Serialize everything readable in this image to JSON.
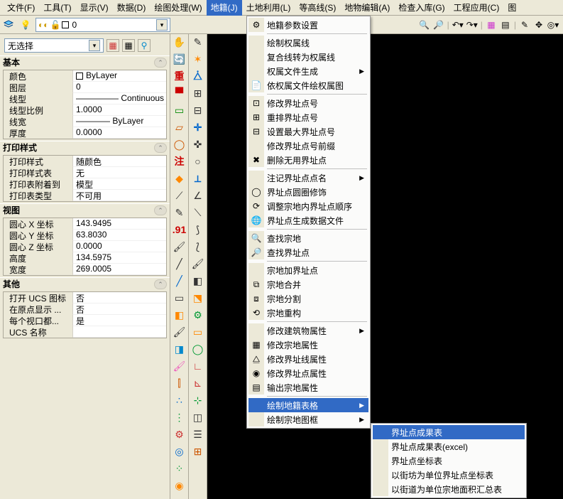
{
  "menubar": {
    "items": [
      "文件(F)",
      "工具(T)",
      "显示(V)",
      "数据(D)",
      "绘图处理(W)",
      "地籍(J)",
      "土地利用(L)",
      "等高线(S)",
      "地物编辑(A)",
      "检查入库(G)",
      "工程应用(C)",
      "图"
    ]
  },
  "layer_combo": {
    "value": "0"
  },
  "selection_combo": {
    "value": "无选择"
  },
  "groups": {
    "basic": {
      "title": "基本",
      "rows": [
        {
          "label": "颜色",
          "value": "ByLayer",
          "swatch": true
        },
        {
          "label": "图层",
          "value": "0"
        },
        {
          "label": "线型",
          "value": "————— Continuous"
        },
        {
          "label": "线型比例",
          "value": "1.0000"
        },
        {
          "label": "线宽",
          "value": "———— ByLayer"
        },
        {
          "label": "厚度",
          "value": "0.0000"
        }
      ]
    },
    "print": {
      "title": "打印样式",
      "rows": [
        {
          "label": "打印样式",
          "value": "随颜色"
        },
        {
          "label": "打印样式表",
          "value": "无"
        },
        {
          "label": "打印表附着到",
          "value": "模型"
        },
        {
          "label": "打印表类型",
          "value": "不可用"
        }
      ]
    },
    "view": {
      "title": "视图",
      "rows": [
        {
          "label": "圆心 X 坐标",
          "value": "143.9495"
        },
        {
          "label": "圆心 Y 坐标",
          "value": "63.8030"
        },
        {
          "label": "圆心 Z 坐标",
          "value": "0.0000"
        },
        {
          "label": "高度",
          "value": "134.5975"
        },
        {
          "label": "宽度",
          "value": "269.0005"
        }
      ]
    },
    "other": {
      "title": "其他",
      "rows": [
        {
          "label": "打开 UCS 图标",
          "value": "否"
        },
        {
          "label": "在原点显示 ...",
          "value": "否"
        },
        {
          "label": "每个视口都...",
          "value": "是"
        },
        {
          "label": "UCS 名称",
          "value": ""
        }
      ]
    }
  },
  "menu1": {
    "items": [
      {
        "t": "地籍参数设置",
        "ico": "gear"
      },
      {
        "t": "-"
      },
      {
        "t": "绘制权属线"
      },
      {
        "t": "复合线转为权属线"
      },
      {
        "t": "权属文件生成",
        "sub": true
      },
      {
        "t": "依权属文件绘权属图",
        "ico": "doc"
      },
      {
        "t": "-"
      },
      {
        "t": "修改界址点号",
        "ico": "pt1"
      },
      {
        "t": "重排界址点号",
        "ico": "grid"
      },
      {
        "t": "设置最大界址点号",
        "ico": "pt2"
      },
      {
        "t": "修改界址点号前缀"
      },
      {
        "t": "删除无用界址点",
        "ico": "del"
      },
      {
        "t": "-"
      },
      {
        "t": "注记界址点点名",
        "sub": true
      },
      {
        "t": "界址点圆圈修饰",
        "ico": "circ"
      },
      {
        "t": "调整宗地内界址点顺序",
        "ico": "ord"
      },
      {
        "t": "界址点生成数据文件",
        "ico": "globe"
      },
      {
        "t": "-"
      },
      {
        "t": "查找宗地",
        "ico": "find"
      },
      {
        "t": "查找界址点",
        "ico": "find2"
      },
      {
        "t": "-"
      },
      {
        "t": "宗地加界址点"
      },
      {
        "t": "宗地合并",
        "ico": "merge"
      },
      {
        "t": "宗地分割",
        "ico": "split"
      },
      {
        "t": "宗地重构",
        "ico": "recon"
      },
      {
        "t": "-"
      },
      {
        "t": "修改建筑物属性",
        "sub": true
      },
      {
        "t": "修改宗地属性",
        "ico": "p1"
      },
      {
        "t": "修改界址线属性",
        "ico": "p2"
      },
      {
        "t": "修改界址点属性",
        "ico": "p3"
      },
      {
        "t": "输出宗地属性",
        "ico": "out"
      },
      {
        "t": "-"
      },
      {
        "t": "绘制地籍表格",
        "sub": true,
        "hi": true
      },
      {
        "t": "绘制宗地图框",
        "sub": true
      }
    ]
  },
  "menu2": {
    "items": [
      {
        "t": "界址点成果表",
        "hi": true
      },
      {
        "t": "界址点成果表(excel)"
      },
      {
        "t": "界址点坐标表"
      },
      {
        "t": "以街坊为单位界址点坐标表"
      },
      {
        "t": "以街道为单位宗地面积汇总表"
      }
    ]
  },
  "vtools1": [
    "hand",
    "rot",
    "red1",
    "red2",
    "rec",
    "tri",
    "circle",
    "ann",
    "orange",
    "mag",
    "pen",
    "dot91",
    "brush",
    "line",
    "line2",
    "erase"
  ],
  "vtools2": [
    "grid",
    "mirror",
    "arr",
    "arr2",
    "cross",
    "cross2",
    "ring",
    "ptA",
    "ptB",
    "dash",
    "curve",
    "curve2",
    "poly",
    "shape"
  ]
}
